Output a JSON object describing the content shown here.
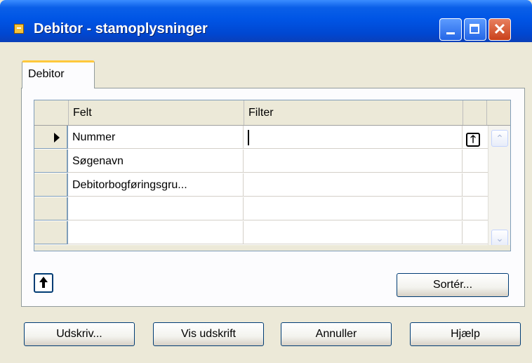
{
  "window": {
    "title": "Debitor - stamoplysninger",
    "icon": "app-icon"
  },
  "tabs": [
    {
      "label": "Debitor",
      "active": true
    }
  ],
  "grid": {
    "columns": [
      "Felt",
      "Filter"
    ],
    "rows": [
      {
        "felt": "Nummer",
        "filter": "",
        "current": true
      },
      {
        "felt": "Søgenavn",
        "filter": ""
      },
      {
        "felt": "Debitorbogføringsgru...",
        "filter": ""
      },
      {
        "felt": "",
        "filter": ""
      },
      {
        "felt": "",
        "filter": ""
      }
    ]
  },
  "buttons": {
    "sort": "Sortér...",
    "print": "Udskriv...",
    "preview": "Vis udskrift",
    "cancel": "Annuller",
    "help": "Hjælp"
  },
  "colors": {
    "titlebar": "#0055E5",
    "tab_highlight": "#FFC83C",
    "face": "#ECE9D8"
  }
}
